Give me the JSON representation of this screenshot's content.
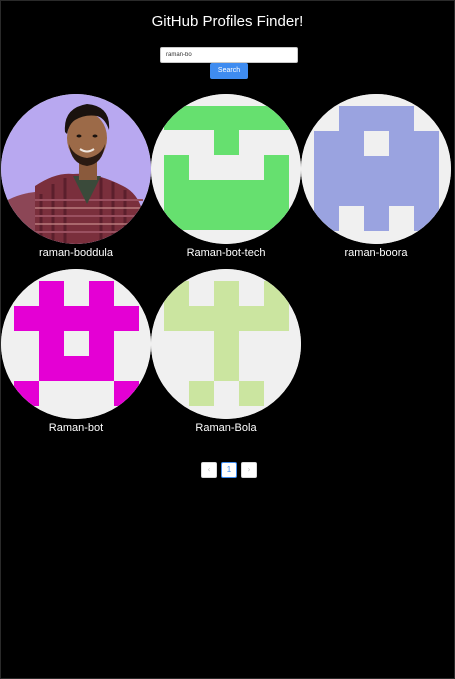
{
  "app": {
    "title": "GitHub Profiles Finder!"
  },
  "search": {
    "value": "raman-bo",
    "button_label": "Search"
  },
  "results": [
    {
      "username": "raman-boddula",
      "avatar": "photo"
    },
    {
      "username": "Raman-bot-tech",
      "avatar": "identicon",
      "color": "#66e06f"
    },
    {
      "username": "raman-boora",
      "avatar": "identicon",
      "color": "#9aa3e0"
    },
    {
      "username": "Raman-bot",
      "avatar": "identicon",
      "color": "#e400d4"
    },
    {
      "username": "Raman-Bola",
      "avatar": "identicon",
      "color": "#cbe5a0"
    }
  ],
  "pagination": {
    "prev_icon": "chevron-left-icon",
    "current_page": "1",
    "next_icon": "chevron-right-icon"
  }
}
